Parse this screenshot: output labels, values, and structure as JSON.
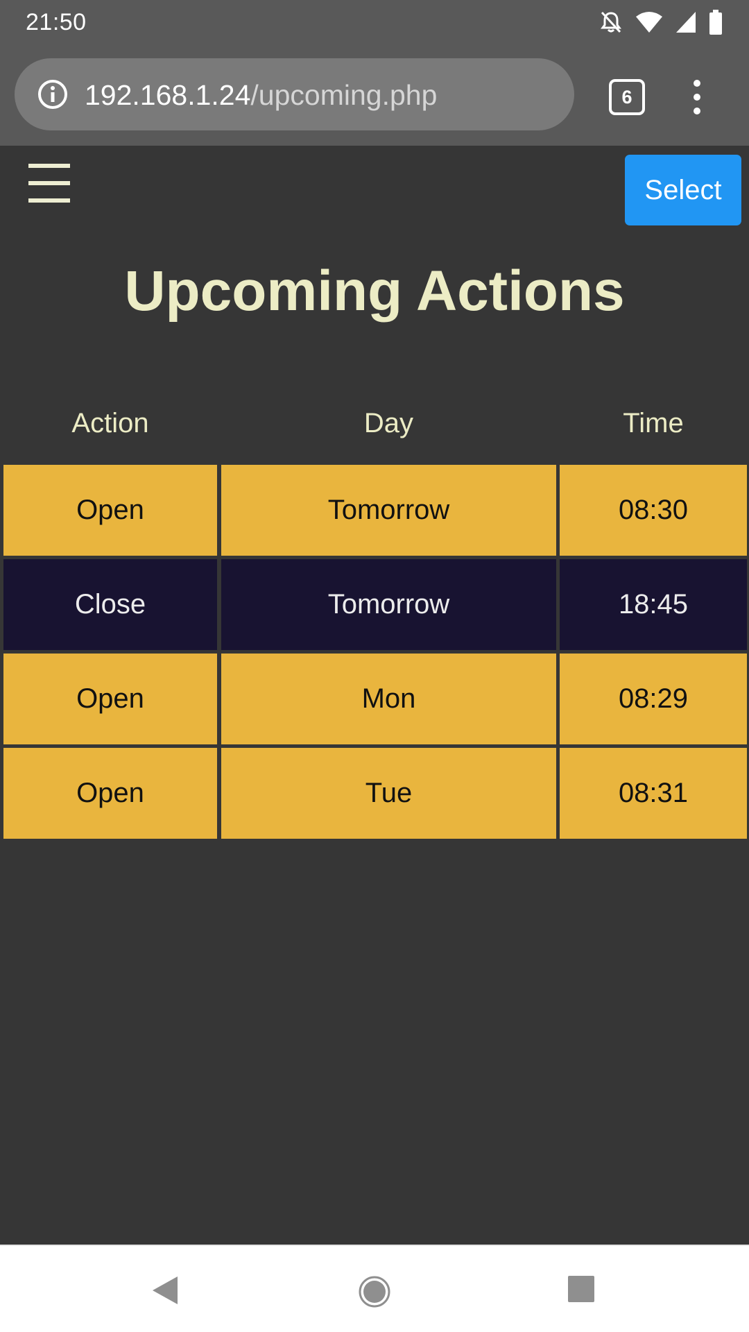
{
  "status_bar": {
    "time": "21:50",
    "icons": [
      "notifications-off-icon",
      "wifi-icon",
      "cell-signal-icon",
      "battery-icon"
    ]
  },
  "browser": {
    "url_host": "192.168.1.24",
    "url_path": "/upcoming.php",
    "tab_count": "6"
  },
  "page": {
    "title": "Upcoming Actions",
    "select_label": "Select",
    "menu_icon": "hamburger-menu-icon"
  },
  "table": {
    "headers": {
      "action": "Action",
      "day": "Day",
      "time": "Time"
    },
    "rows": [
      {
        "action": "Open",
        "day": "Tomorrow",
        "time": "08:30"
      },
      {
        "action": "Close",
        "day": "Tomorrow",
        "time": "18:45"
      },
      {
        "action": "Open",
        "day": "Mon",
        "time": "08:29"
      },
      {
        "action": "Open",
        "day": "Tue",
        "time": "08:31"
      }
    ]
  },
  "colors": {
    "page_background": "#363636",
    "title_text": "#ececc5",
    "open_row": "#e9b53e",
    "close_row": "#181331",
    "select_button": "#2196f3"
  },
  "nav_bar": {
    "icons": [
      "back-icon",
      "home-icon",
      "recents-icon"
    ]
  }
}
